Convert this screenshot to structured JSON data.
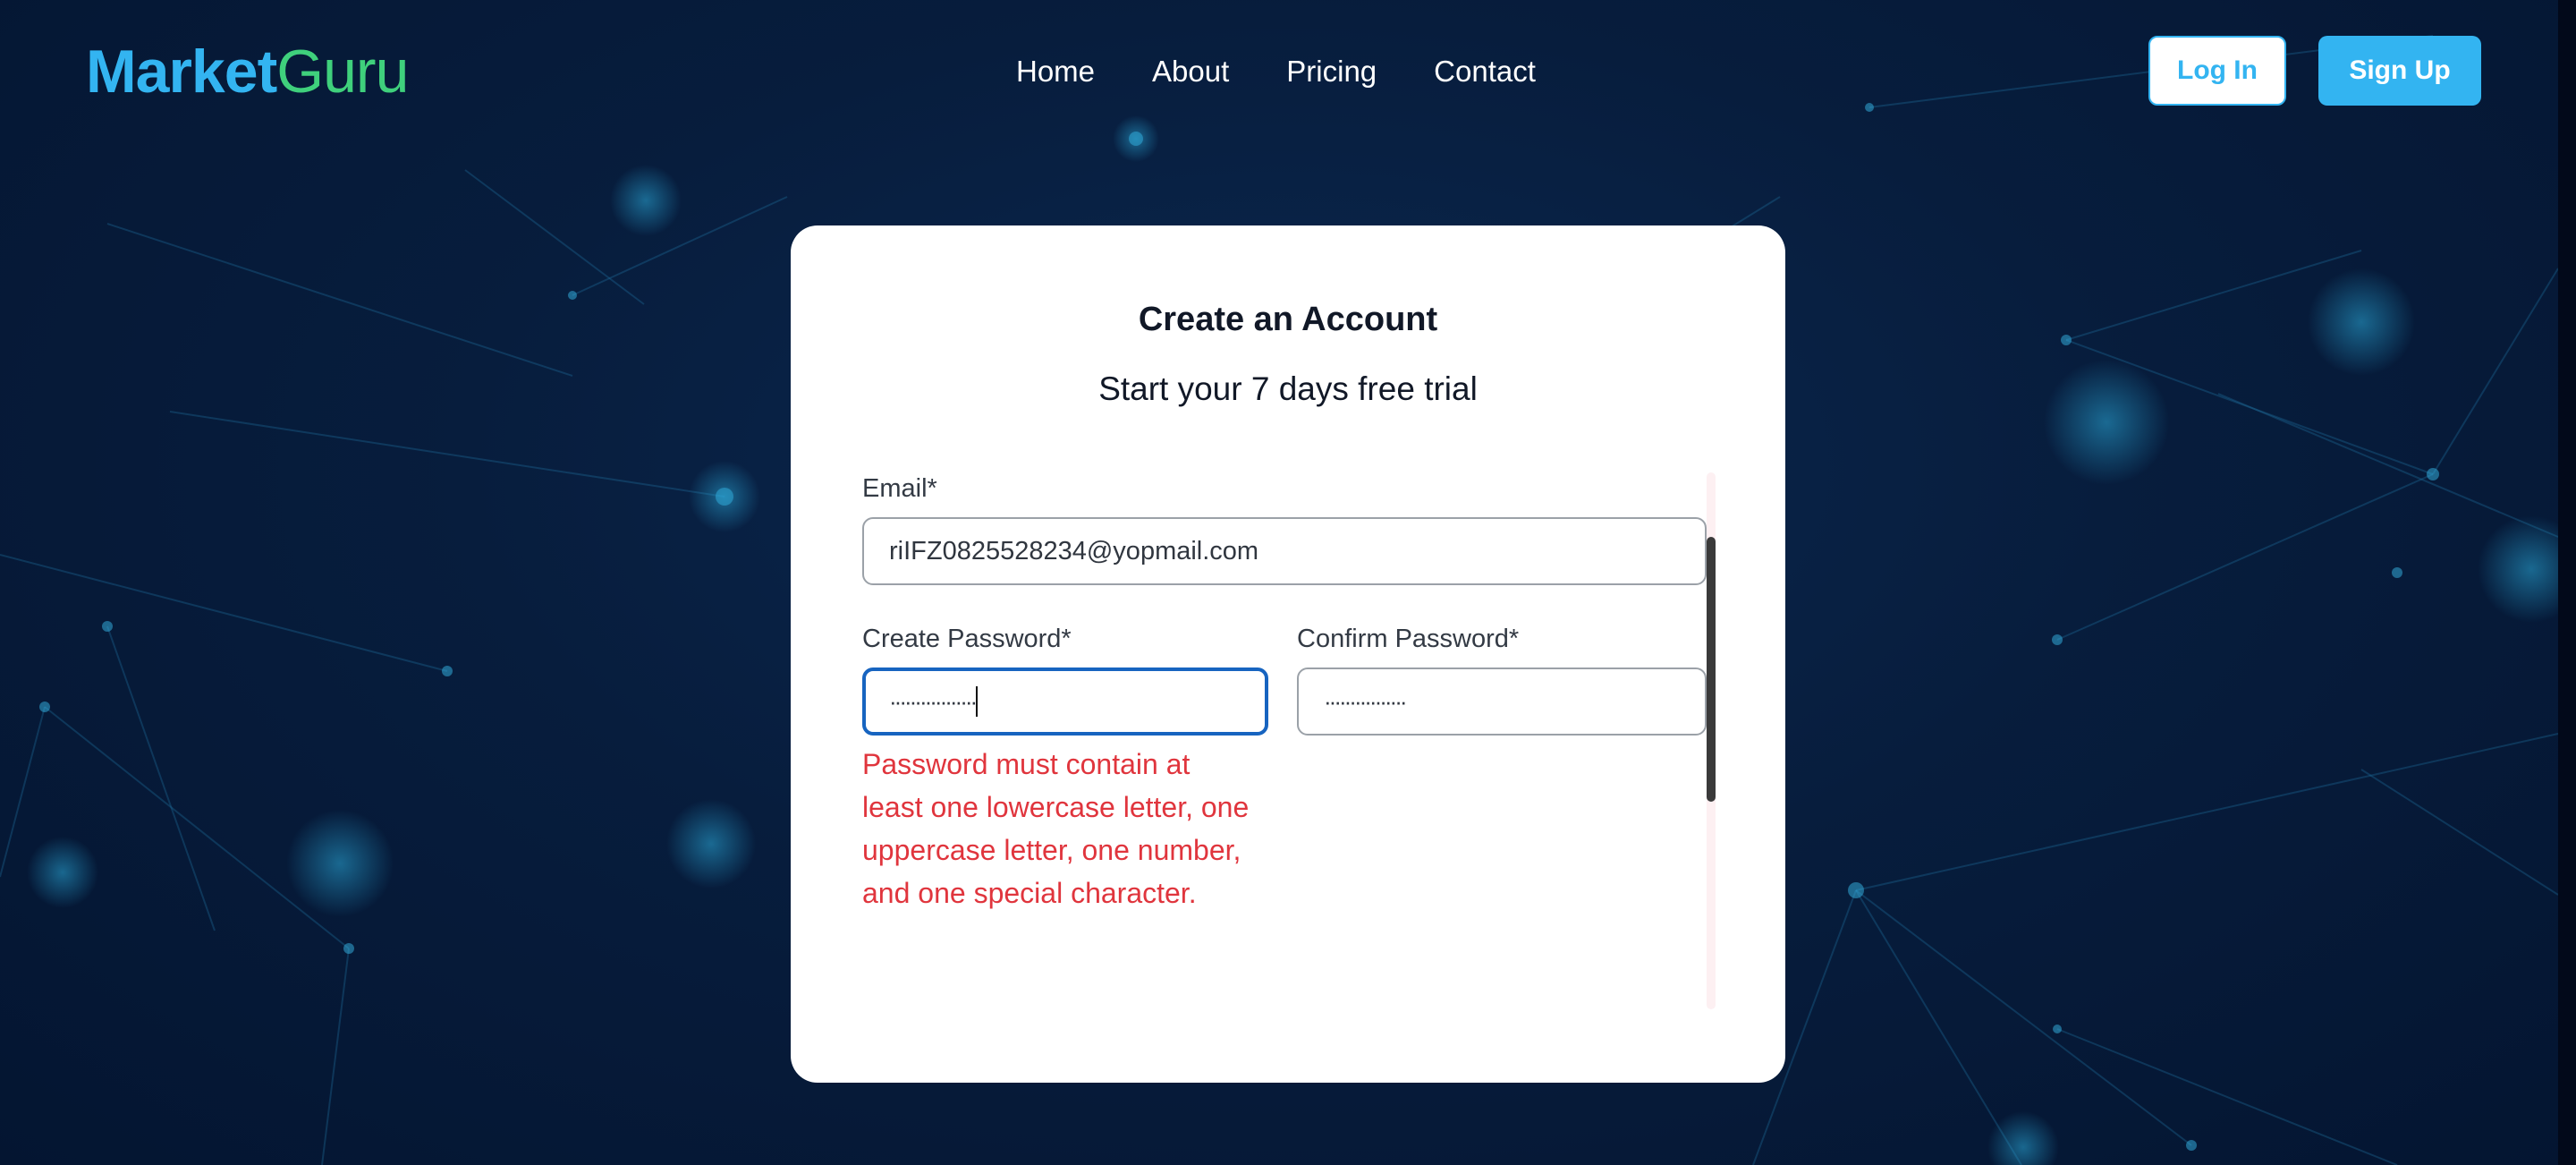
{
  "brand": {
    "name_part1": "Market",
    "name_part2": "Guru",
    "primary_color": "#33b4f1",
    "secondary_color": "#3fd07c"
  },
  "nav": {
    "items": [
      "Home",
      "About",
      "Pricing",
      "Contact"
    ]
  },
  "auth": {
    "login_label": "Log In",
    "signup_label": "Sign Up"
  },
  "form": {
    "title": "Create an Account",
    "subtitle": "Start your 7 days free trial",
    "email": {
      "label": "Email*",
      "value": "riIFZ0825528234@yopmail.com"
    },
    "create_password": {
      "label": "Create Password*",
      "value_masked": "·················"
    },
    "confirm_password": {
      "label": "Confirm Password*",
      "value_masked": "················"
    },
    "error": "Password must contain at least one lowercase letter, one uppercase letter, one number, and one special character.",
    "error_color": "#e0353d",
    "focus_color": "#1764c0"
  },
  "icons": {
    "background": "network-pattern"
  }
}
